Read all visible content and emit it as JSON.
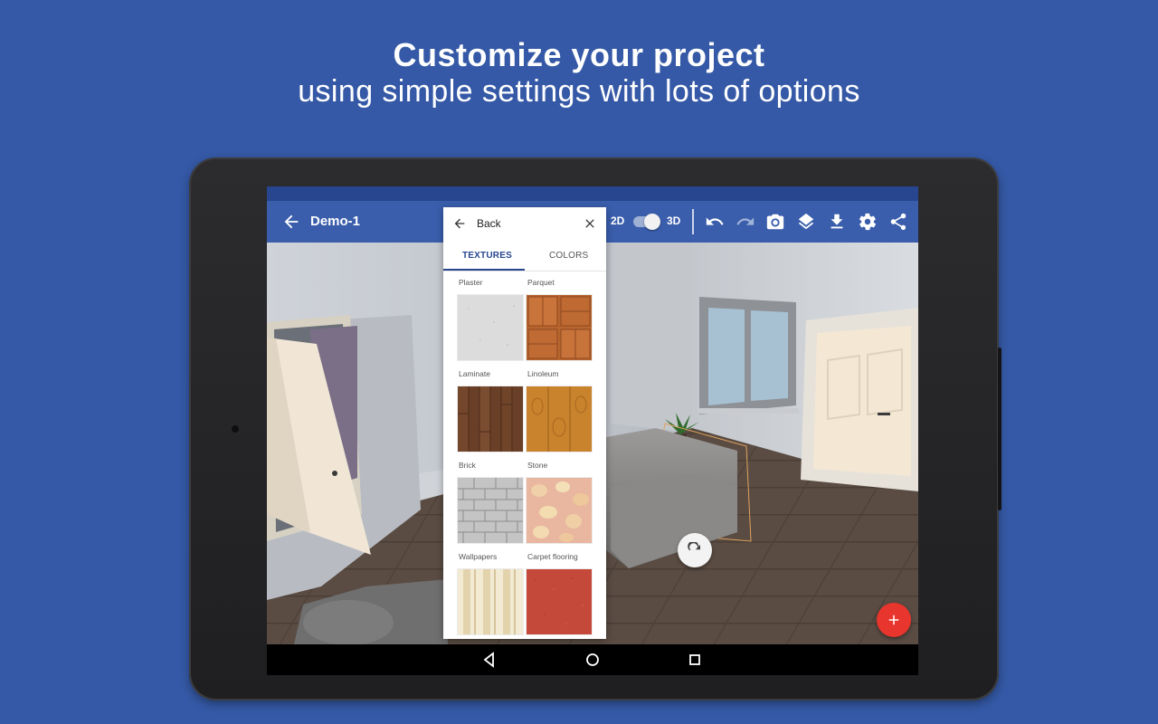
{
  "promo": {
    "headline": "Customize your project",
    "subheadline": "using simple settings with lots of options"
  },
  "toolbar": {
    "project_title": "Demo-1",
    "mode_2d": "2D",
    "mode_3d": "3D",
    "mode_toggle_state": "3D",
    "icons": [
      "back-arrow-icon",
      "undo-icon",
      "redo-icon",
      "camera-icon",
      "layers-icon",
      "download-icon",
      "settings-icon",
      "share-icon"
    ]
  },
  "panel": {
    "back_label": "Back",
    "tabs": [
      {
        "label": "TEXTURES",
        "active": true
      },
      {
        "label": "COLORS",
        "active": false
      }
    ],
    "textures": [
      {
        "label": "Plaster"
      },
      {
        "label": "Parquet"
      },
      {
        "label": "Laminate"
      },
      {
        "label": "Linoleum"
      },
      {
        "label": "Brick"
      },
      {
        "label": "Stone"
      },
      {
        "label": "Wallpapers"
      },
      {
        "label": "Carpet flooring"
      }
    ]
  },
  "colors": {
    "background": "#3559a6",
    "toolbar": "#3a5eac",
    "statusbar": "#27468f",
    "active_tab": "#27468f",
    "fab_add": "#e8352e"
  }
}
